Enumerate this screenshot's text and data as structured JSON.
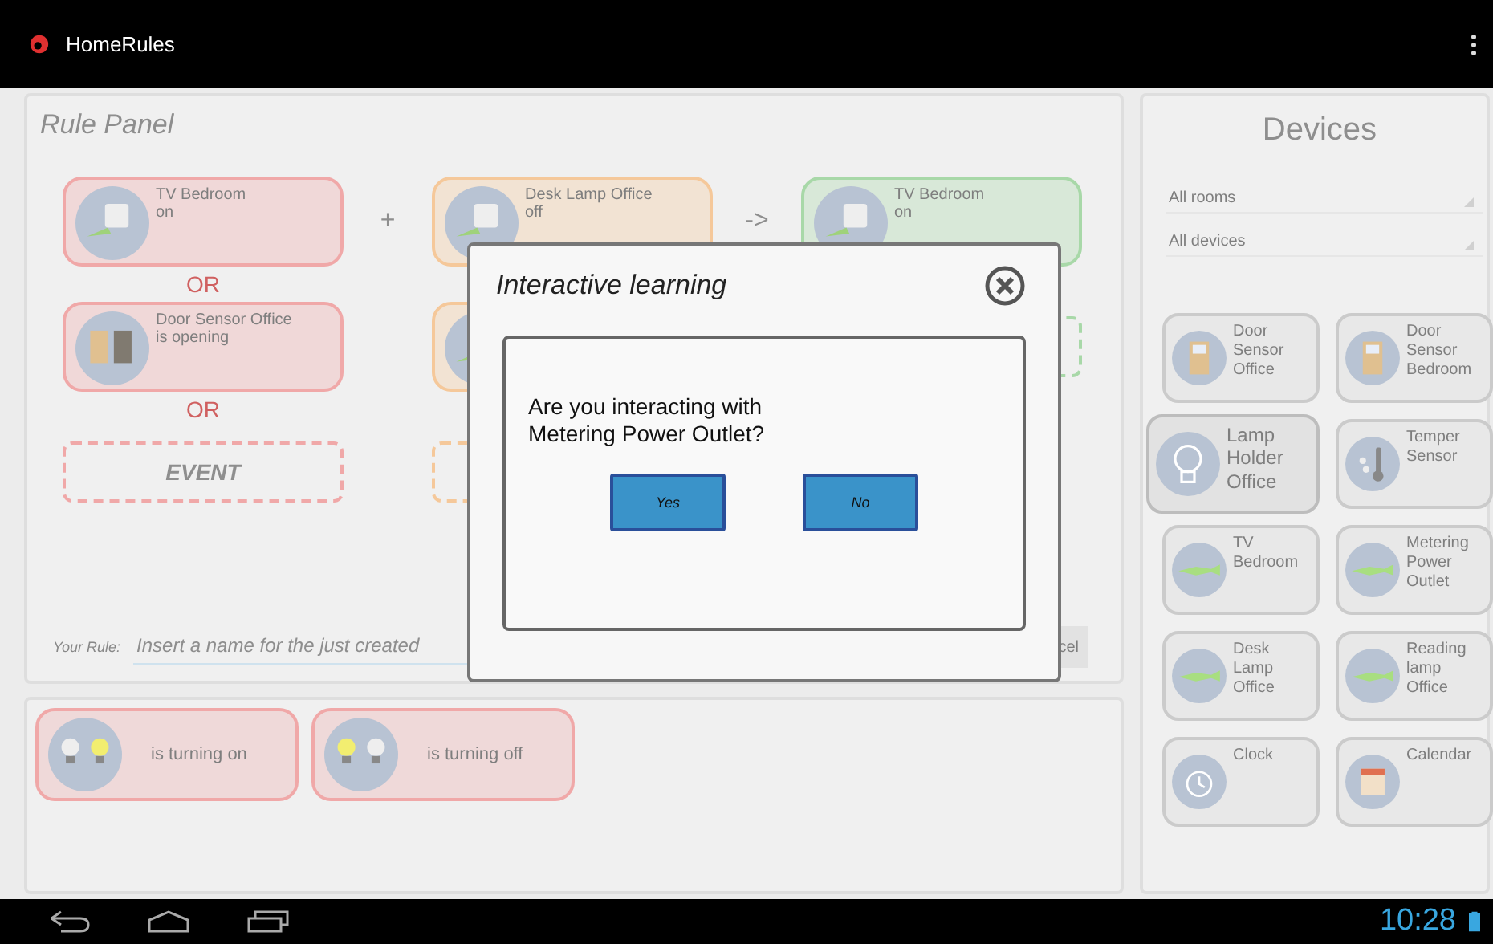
{
  "app_bar": {
    "title": "HomeRules"
  },
  "rule_panel": {
    "title": "Rule Panel",
    "rows": [
      {
        "kind": "cards",
        "first": {
          "kind": "plug",
          "color": "#f0a8a8",
          "name": "TV Bedroom",
          "state": "on"
        },
        "op1": "+",
        "second": {
          "kind": "plug",
          "color": "#f5c89a",
          "name": "Desk Lamp Office",
          "state": "off"
        },
        "op2": "->",
        "third": {
          "kind": "plug",
          "color": "#a8d8a8",
          "name": "TV Bedroom",
          "state": "on"
        }
      },
      {
        "kind": "separator",
        "text": "OR"
      },
      {
        "kind": "cards",
        "first": {
          "kind": "door",
          "color": "#f0a8a8",
          "name": "Door Sensor Office",
          "state": "is opening"
        },
        "second": {
          "kind": "plug",
          "color": "#f5c89a"
        },
        "third": {
          "kind": "slot",
          "color": "#a8d8a8"
        }
      },
      {
        "kind": "separator",
        "text": "OR"
      },
      {
        "kind": "cards",
        "first": {
          "kind": "slot",
          "color": "#f0a8a8",
          "label": "EVENT"
        },
        "second": {
          "kind": "slot",
          "color": "#f5c89a"
        }
      }
    ],
    "rule_label": "Your Rule:",
    "rule_placeholder": "Insert a name for the just created",
    "cancel": "cel"
  },
  "event_panel": {
    "events": [
      {
        "text": "is turning on"
      },
      {
        "text": "is turning off"
      }
    ]
  },
  "devices": {
    "title": "Devices",
    "filters": [
      "All rooms",
      "All devices"
    ],
    "items": [
      {
        "kind": "door",
        "name": "Door Sensor Office",
        "selected": false
      },
      {
        "kind": "door",
        "name": "Door Sensor Bedroom",
        "selected": false
      },
      {
        "kind": "bulb",
        "name": "Lamp Holder Office",
        "selected": true
      },
      {
        "kind": "thermometer",
        "name": "Temper Sensor",
        "selected": false
      },
      {
        "kind": "plug",
        "name": "TV Bedroom",
        "selected": false
      },
      {
        "kind": "plug",
        "name": "Metering Power Outlet",
        "selected": false
      },
      {
        "kind": "plug",
        "name": "Desk Lamp Office",
        "selected": false
      },
      {
        "kind": "plug",
        "name": "Reading lamp Office",
        "selected": false
      },
      {
        "kind": "clock",
        "name": "Clock",
        "selected": false
      },
      {
        "kind": "calendar",
        "name": "Calendar",
        "selected": false
      }
    ]
  },
  "dialog": {
    "title": "Interactive learning",
    "message": "Are you interacting with\nMetering Power Outlet?",
    "buttons": [
      "Yes",
      "No"
    ]
  },
  "system_bar": {
    "time": "10:28"
  }
}
